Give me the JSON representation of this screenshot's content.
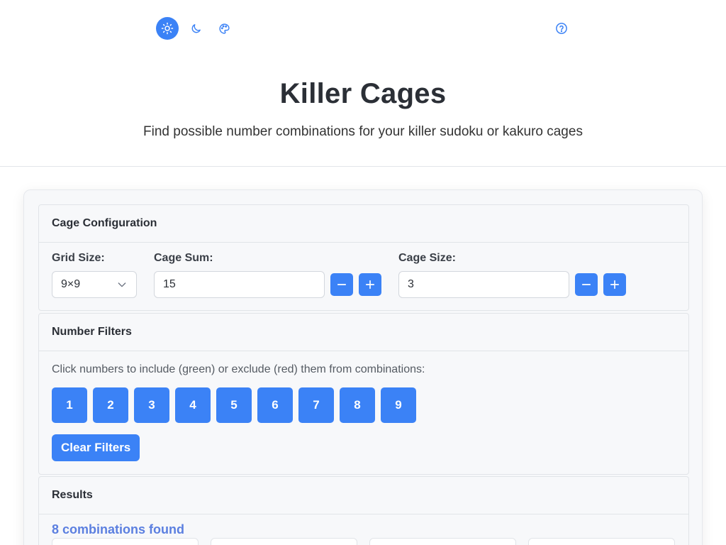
{
  "header": {
    "theme_icons": [
      "sun-icon",
      "moon-icon",
      "palette-icon"
    ],
    "active_theme": "light",
    "help_icon": "question-circle-icon",
    "title": "Killer Cages",
    "subtitle": "Find possible number combinations for your killer sudoku or kakuro cages"
  },
  "config": {
    "heading": "Cage Configuration",
    "grid_size_label": "Grid Size:",
    "grid_size_value": "9×9",
    "cage_sum_label": "Cage Sum:",
    "cage_sum_value": "15",
    "cage_size_label": "Cage Size:",
    "cage_size_value": "3"
  },
  "filters": {
    "heading": "Number Filters",
    "hint": "Click numbers to include (green) or exclude (red) them from combinations:",
    "numbers": [
      "1",
      "2",
      "3",
      "4",
      "5",
      "6",
      "7",
      "8",
      "9"
    ],
    "clear_label": "Clear Filters"
  },
  "results": {
    "heading": "Results",
    "count_text": "8 combinations found"
  },
  "colors": {
    "accent": "#3b82f6",
    "count_text": "#5b7fe0",
    "card_bg": "#f7f8fa"
  }
}
